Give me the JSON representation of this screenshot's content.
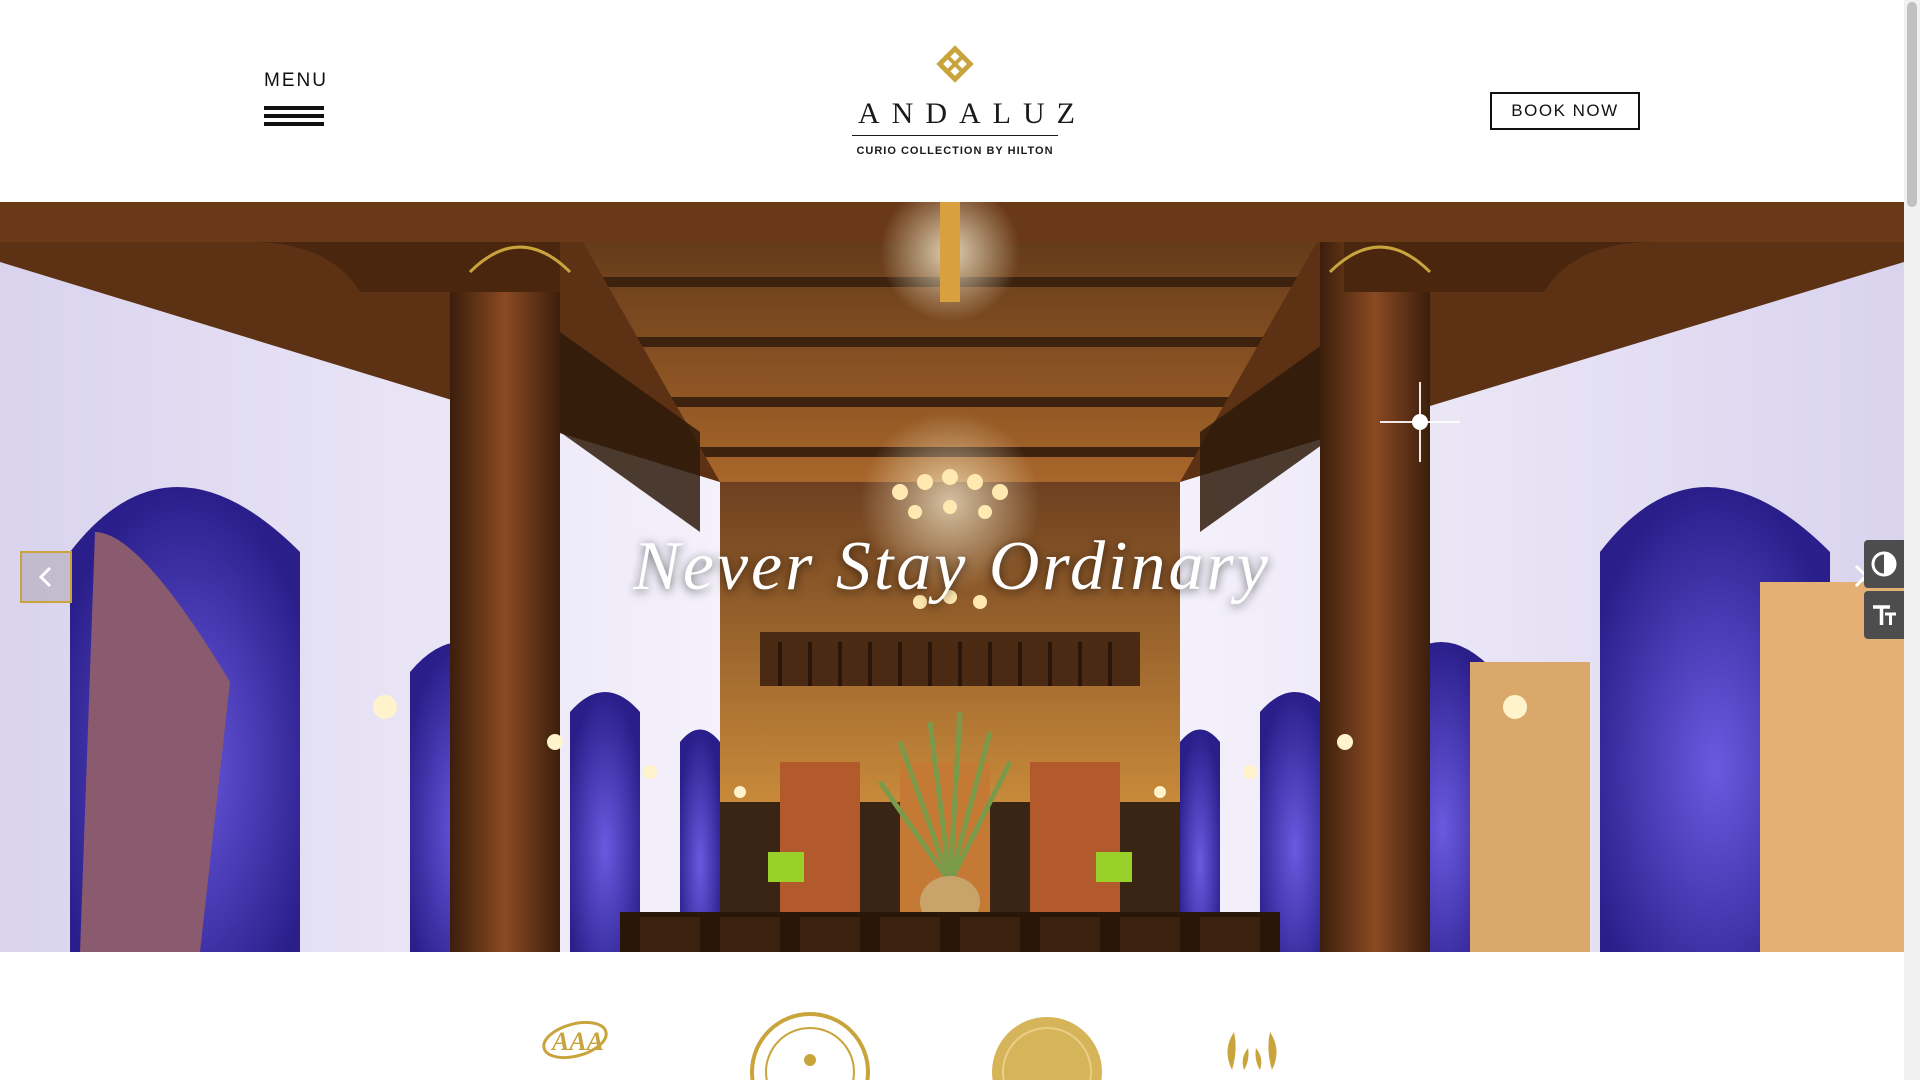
{
  "header": {
    "menu_label": "MENU",
    "logo": {
      "name": "ANDALUZ",
      "subtitle": "CURIO COLLECTION BY HILTON",
      "mark_icon": "knot-emblem-icon"
    },
    "book_button": "BOOK NOW"
  },
  "hero": {
    "title": "Never Stay Ordinary",
    "prev_icon": "chevron-left-icon",
    "next_icon": "chevron-right-icon"
  },
  "accessibility": {
    "contrast_icon": "contrast-icon",
    "text_size_icon": "text-size-icon"
  },
  "awards": {
    "items": [
      {
        "icon": "aaa-logo-icon"
      },
      {
        "icon": "green-building-seal-icon"
      },
      {
        "icon": "award-seal-icon"
      },
      {
        "icon": "laurel-award-icon"
      }
    ]
  },
  "colors": {
    "accent_gold": "#c9a43c",
    "text_dark": "#111111",
    "widget_grey": "#4d4d4d"
  }
}
